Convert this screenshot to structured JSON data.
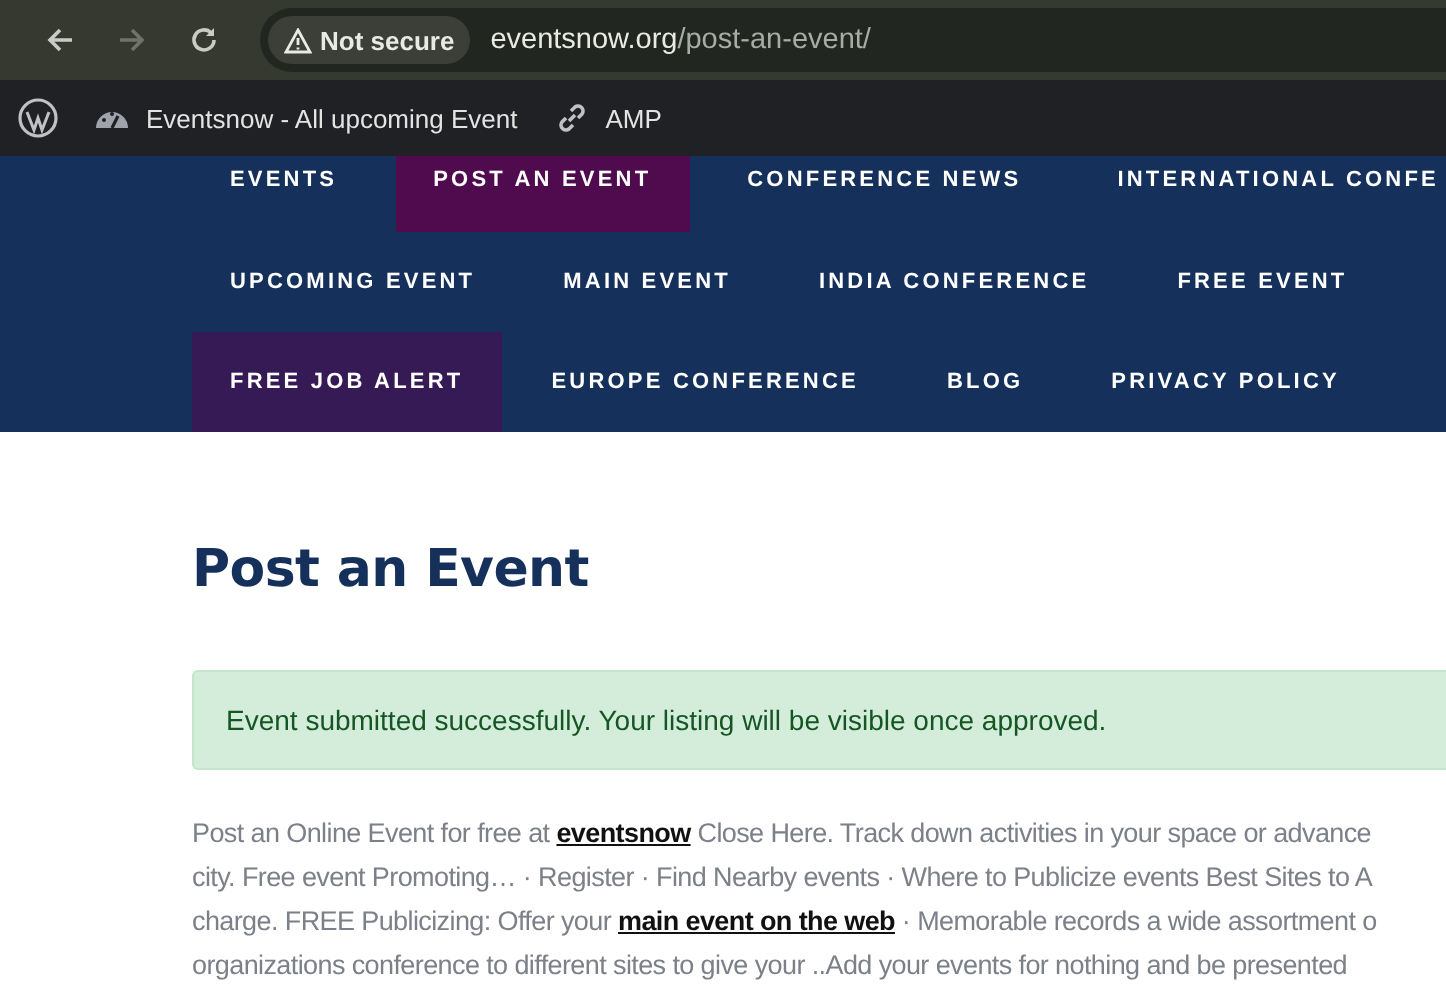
{
  "browser": {
    "security_label": "Not secure",
    "url_host": "eventsnow.org",
    "url_path": "/post-an-event/",
    "forward_disabled": true
  },
  "bookmarks": [
    {
      "kind": "wordpress"
    },
    {
      "kind": "gauge",
      "label": "Eventsnow - All upcoming Event"
    },
    {
      "kind": "link",
      "label": "AMP"
    }
  ],
  "nav": {
    "rows": [
      [
        {
          "label": "EVENTS",
          "selected": false,
          "highlighted": false
        },
        {
          "label": "POST AN EVENT",
          "selected": true,
          "highlighted": false
        },
        {
          "label": "CONFERENCE NEWS",
          "selected": false,
          "highlighted": false
        },
        {
          "label": "INTERNATIONAL CONFE",
          "selected": false,
          "highlighted": false
        }
      ],
      [
        {
          "label": "UPCOMING EVENT",
          "selected": false,
          "highlighted": false
        },
        {
          "label": "MAIN EVENT",
          "selected": false,
          "highlighted": false
        },
        {
          "label": "INDIA CONFERENCE",
          "selected": false,
          "highlighted": false
        },
        {
          "label": "FREE EVENT",
          "selected": false,
          "highlighted": false
        }
      ],
      [
        {
          "label": "FREE JOB ALERT",
          "selected": false,
          "highlighted": true
        },
        {
          "label": "EUROPE CONFERENCE",
          "selected": false,
          "highlighted": false
        },
        {
          "label": "BLOG",
          "selected": false,
          "highlighted": false
        },
        {
          "label": "PRIVACY POLICY",
          "selected": false,
          "highlighted": false
        }
      ]
    ]
  },
  "page": {
    "title": "Post an Event",
    "alert": "Event submitted successfully. Your listing will be visible once approved.",
    "intro_lines": [
      [
        {
          "kind": "text",
          "text": "Post an Online Event for free at "
        },
        {
          "kind": "link",
          "text": "eventsnow"
        },
        {
          "kind": "text",
          "text": " Close Here. Track down activities in your space or advance"
        }
      ],
      [
        {
          "kind": "text",
          "text": "city. Free event Promoting… · Register · Find Nearby events · Where to Publicize events Best Sites to A"
        }
      ],
      [
        {
          "kind": "text",
          "text": "charge. FREE Publicizing: Offer your "
        },
        {
          "kind": "link",
          "text": "main event on the web"
        },
        {
          "kind": "text",
          "text": " · Memorable records a wide assortment o"
        }
      ],
      [
        {
          "kind": "text",
          "text": "organizations conference to different sites to give your ..Add your events for nothing and be presented"
        }
      ]
    ]
  }
}
